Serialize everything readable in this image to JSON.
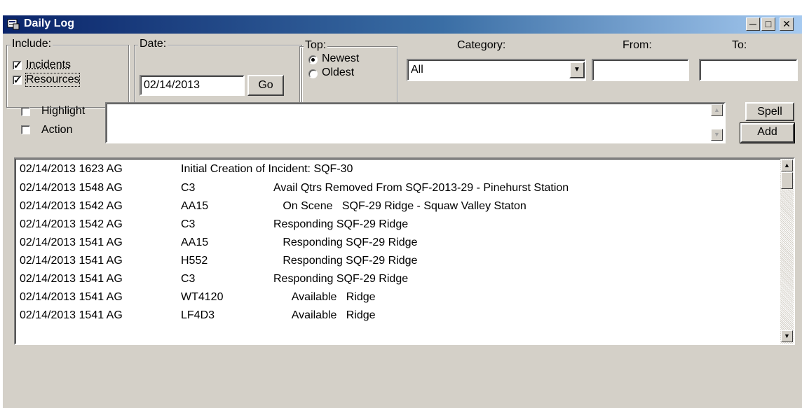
{
  "window": {
    "title": "Daily Log"
  },
  "include": {
    "legend": "Include:",
    "incidents": {
      "label": "Incidents",
      "checked": true
    },
    "resources": {
      "label": "Resources",
      "checked": true
    }
  },
  "date": {
    "legend": "Date:",
    "value": "02/14/2013",
    "go_label": "Go"
  },
  "top": {
    "legend": "Top:",
    "newest_label": "Newest",
    "oldest_label": "Oldest",
    "selected": "Newest"
  },
  "category": {
    "label": "Category:",
    "value": "All"
  },
  "from": {
    "label": "From:",
    "value": ""
  },
  "to": {
    "label": "To:",
    "value": ""
  },
  "entry": {
    "highlight": {
      "label": "Highlight",
      "checked": false
    },
    "action": {
      "label": "Action",
      "checked": false
    },
    "text": "",
    "spell_label": "Spell",
    "add_label": "Add"
  },
  "log": {
    "rows": [
      {
        "datetime": "02/14/2013 1623 AG",
        "unit": "Initial Creation of Incident:  SQF-30",
        "text": ""
      },
      {
        "datetime": "02/14/2013 1548 AG",
        "unit": "C3",
        "text": "Avail Qtrs  Removed From SQF-2013-29 - Pinehurst Station"
      },
      {
        "datetime": "02/14/2013 1542 AG",
        "unit": "AA15",
        "text": "   On Scene   SQF-29 Ridge - Squaw Valley Staton"
      },
      {
        "datetime": "02/14/2013 1542 AG",
        "unit": "C3",
        "text": "Responding SQF-29 Ridge"
      },
      {
        "datetime": "02/14/2013 1541 AG",
        "unit": "AA15",
        "text": "   Responding SQF-29 Ridge"
      },
      {
        "datetime": "02/14/2013 1541 AG",
        "unit": "H552",
        "text": "   Responding SQF-29 Ridge"
      },
      {
        "datetime": "02/14/2013 1541 AG",
        "unit": "C3",
        "text": "Responding SQF-29 Ridge"
      },
      {
        "datetime": "02/14/2013 1541 AG",
        "unit": "WT4120",
        "text": "      Available   Ridge"
      },
      {
        "datetime": "02/14/2013 1541 AG",
        "unit": "LF4D3",
        "text": "      Available   Ridge"
      }
    ]
  },
  "colors": {
    "face": "#d4d0c8",
    "titlebar_start": "#0a246a",
    "titlebar_end": "#a6caf0"
  }
}
